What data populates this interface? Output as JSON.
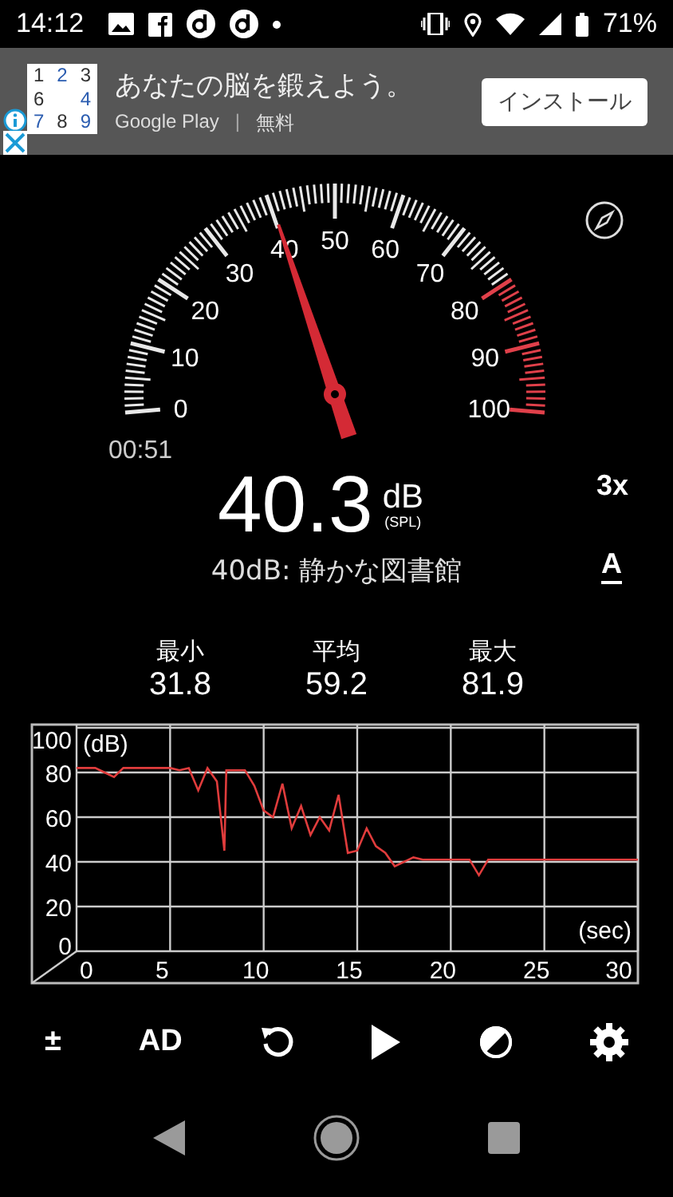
{
  "status_bar": {
    "time": "14:12",
    "battery": "71%"
  },
  "ad": {
    "icon_digits": [
      "1",
      "2",
      "3",
      "6",
      "4",
      "7",
      "8",
      "9"
    ],
    "title": "あなたの脳を鍛えよう。",
    "store": "Google Play",
    "separator": "|",
    "price": "無料",
    "button": "インストール"
  },
  "gauge": {
    "scale": [
      "0",
      "10",
      "20",
      "30",
      "40",
      "50",
      "60",
      "70",
      "80",
      "90",
      "100"
    ],
    "elapsed": "00:51"
  },
  "reading": {
    "value": "40.3",
    "unit": "dB",
    "weighting": "(SPL)",
    "zoom": "3x"
  },
  "description": "40dB: 静かな図書館",
  "weighting_button": "A",
  "stats": [
    {
      "label": "最小",
      "value": "31.8"
    },
    {
      "label": "平均",
      "value": "59.2"
    },
    {
      "label": "最大",
      "value": "81.9"
    }
  ],
  "chart": {
    "chart_data": {
      "type": "line",
      "grid": true,
      "xlabel": "(sec)",
      "ylabel": "(dB)",
      "xlim": [
        0,
        30
      ],
      "ylim": [
        0,
        100
      ],
      "xticks": [
        0,
        5,
        10,
        15,
        20,
        25,
        30
      ],
      "yticks": [
        0,
        20,
        40,
        60,
        80,
        100
      ],
      "x": [
        0,
        0.5,
        1,
        1.5,
        2,
        2.5,
        3,
        3.5,
        4,
        4.5,
        5,
        5.5,
        6,
        6.5,
        7,
        7.5,
        7.9,
        8,
        8.5,
        9,
        9.5,
        10,
        10.5,
        11,
        11.5,
        12,
        12.5,
        13,
        13.5,
        14,
        14.5,
        15,
        15.5,
        16,
        16.5,
        17,
        17.5,
        18,
        18.5,
        19,
        20,
        21,
        21.5,
        22,
        23,
        24,
        25,
        26,
        27,
        28,
        29,
        30
      ],
      "series": [
        {
          "color": "#e03c3c",
          "values": [
            82,
            82,
            82,
            80,
            78,
            82,
            82,
            82,
            82,
            82,
            82,
            81,
            82,
            72,
            82,
            76,
            45,
            81,
            81,
            81,
            74,
            63,
            60,
            75,
            55,
            65,
            52,
            60,
            54,
            70,
            44,
            45,
            55,
            47,
            44,
            38,
            40,
            42,
            41,
            41,
            41,
            41,
            34,
            41,
            41,
            41,
            41,
            41,
            41,
            41,
            41,
            41
          ]
        }
      ]
    }
  },
  "toolbar": [
    {
      "kind": "text",
      "label": "±"
    },
    {
      "kind": "text",
      "label": "AD"
    },
    {
      "kind": "reset"
    },
    {
      "kind": "play"
    },
    {
      "kind": "contrast"
    },
    {
      "kind": "settings"
    }
  ]
}
